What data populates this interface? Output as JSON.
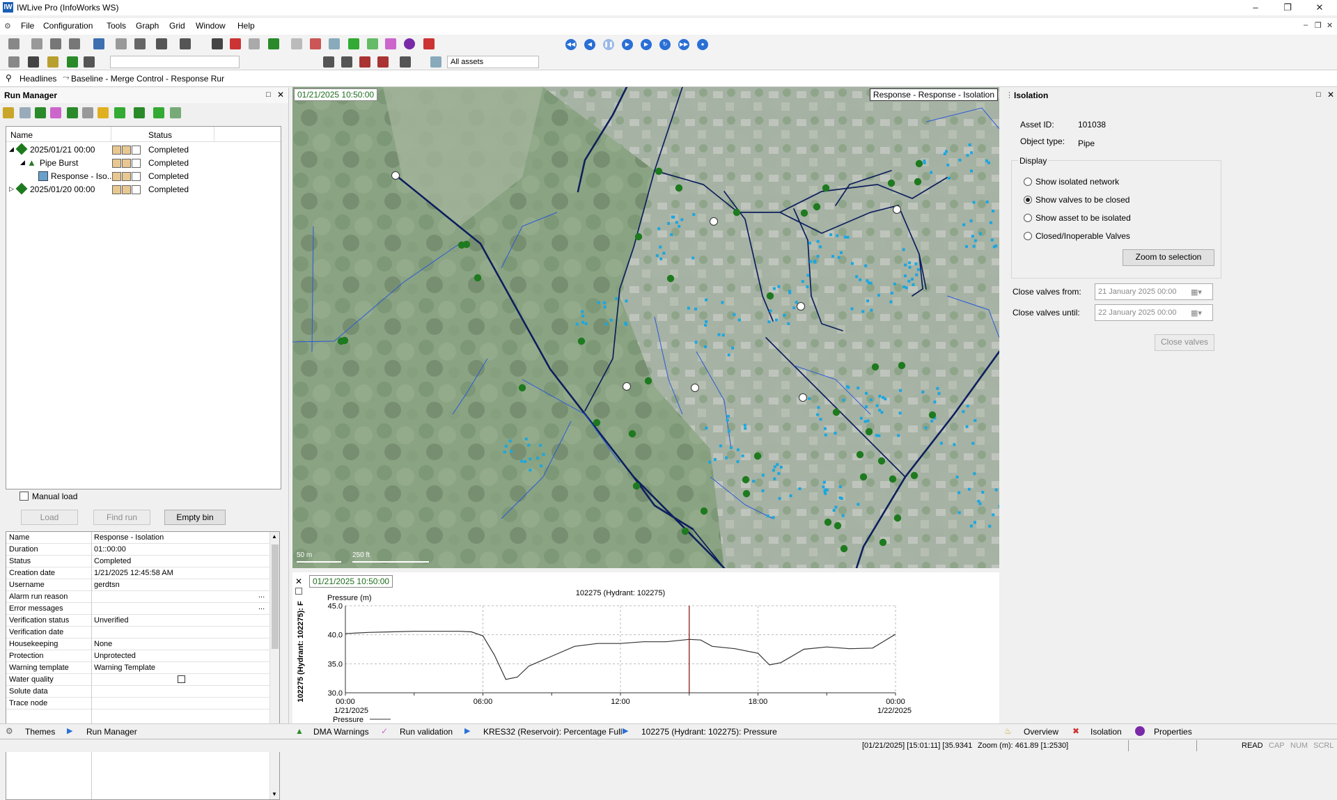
{
  "window": {
    "title": "IWLive Pro (InfoWorks WS)"
  },
  "menu": [
    "File",
    "Configuration",
    "Tools",
    "Graph",
    "Grid",
    "Window",
    "Help"
  ],
  "toolbar": {
    "asset_filter": "All assets"
  },
  "headlines": {
    "label": "Headlines",
    "breadcrumb": "Baseline - Merge Control - Response Rur"
  },
  "run_manager": {
    "title": "Run Manager",
    "columns": [
      "Name",
      "Status"
    ],
    "tree": [
      {
        "name": "2025/01/21 00:00",
        "status": "Completed",
        "level": 0
      },
      {
        "name": "Pipe Burst",
        "status": "Completed",
        "level": 1
      },
      {
        "name": "Response - Iso...",
        "status": "Completed",
        "level": 2
      },
      {
        "name": "2025/01/20 00:00",
        "status": "Completed",
        "level": 0
      }
    ],
    "manual_load": "Manual load",
    "buttons": {
      "load": "Load",
      "find_run": "Find run",
      "empty_bin": "Empty bin"
    },
    "properties": [
      {
        "name": "Name",
        "value": "Response - Isolation"
      },
      {
        "name": "Duration",
        "value": "01::00:00"
      },
      {
        "name": "Status",
        "value": "Completed"
      },
      {
        "name": "Creation date",
        "value": "1/21/2025 12:45:58 AM"
      },
      {
        "name": "Username",
        "value": "gerdtsn"
      },
      {
        "name": "Alarm run reason",
        "value": ""
      },
      {
        "name": "Error messages",
        "value": ""
      },
      {
        "name": "Verification status",
        "value": "Unverified"
      },
      {
        "name": "Verification date",
        "value": ""
      },
      {
        "name": "Housekeeping",
        "value": "None"
      },
      {
        "name": "Protection",
        "value": "Unprotected"
      },
      {
        "name": "Warning template",
        "value": "Warning Template"
      },
      {
        "name": "Water quality",
        "value": ""
      },
      {
        "name": "Solute data",
        "value": ""
      },
      {
        "name": "Trace node",
        "value": ""
      }
    ]
  },
  "map": {
    "timestamp": "01/21/2025 10:50:00",
    "title": "Response - Response - Isolation",
    "scale_1": "50 m",
    "scale_2": "250 ft"
  },
  "graph": {
    "timestamp": "01/21/2025 10:50:00",
    "side_label": "102275 (Hydrant: 102275): F",
    "chart_data": {
      "type": "line",
      "title": "102275 (Hydrant: 102275)",
      "ylabel": "Pressure (m)",
      "ylim": [
        30.0,
        45.0
      ],
      "yticks": [
        "45.0",
        "40.0",
        "35.0",
        "30.0"
      ],
      "xticks": [
        "00:00",
        "06:00",
        "12:00",
        "18:00",
        "00:00"
      ],
      "x_date_start": "1/21/2025",
      "x_date_end": "1/22/2025",
      "legend": "Pressure",
      "series": [
        {
          "name": "Pressure",
          "x": [
            0,
            1,
            2,
            3,
            4,
            5,
            5.5,
            6,
            6.5,
            7,
            7.5,
            8,
            9,
            10,
            11,
            12,
            13,
            14,
            15,
            15.5,
            16,
            17,
            18,
            18.5,
            19,
            20,
            21,
            22,
            23,
            24
          ],
          "values": [
            40.2,
            40.4,
            40.5,
            40.6,
            40.6,
            40.6,
            40.5,
            39.8,
            36.5,
            32.3,
            32.7,
            34.6,
            36.3,
            38.0,
            38.5,
            38.5,
            38.8,
            38.8,
            39.2,
            39.1,
            38.0,
            37.6,
            36.8,
            34.8,
            35.2,
            37.5,
            37.9,
            37.6,
            37.7,
            40.1
          ]
        }
      ],
      "cursor_x": 15
    }
  },
  "isolation": {
    "title": "Isolation",
    "asset_id_label": "Asset ID:",
    "asset_id": "101038",
    "object_type_label": "Object type:",
    "object_type": "Pipe",
    "display_label": "Display",
    "options": [
      {
        "label": "Show isolated network",
        "checked": false
      },
      {
        "label": "Show valves to be closed",
        "checked": true
      },
      {
        "label": "Show asset to be isolated",
        "checked": false
      },
      {
        "label": "Closed/Inoperable Valves",
        "checked": false
      }
    ],
    "zoom_button": "Zoom to selection",
    "close_from_label": "Close valves from:",
    "close_from_value": "21  January   2025  00:00",
    "close_until_label": "Close valves until:",
    "close_until_value": "22  January   2025  00:00",
    "close_button": "Close valves"
  },
  "bottom_tabs": {
    "left": [
      "Themes",
      "Run Manager"
    ],
    "center": [
      "DMA Warnings",
      "Run validation",
      "KRES32 (Reservoir): Percentage Full",
      "102275 (Hydrant: 102275): Pressure"
    ],
    "right": [
      "Overview",
      "Isolation",
      "Properties"
    ]
  },
  "status": {
    "coords": "[01/21/2025] [15:01:11] [35.9341",
    "zoom": "Zoom (m): 461.89 [1:2530]",
    "flags": [
      "READ",
      "CAP",
      "NUM",
      "SCRL"
    ]
  },
  "colors": {
    "pipe_main": "#0d1f5c",
    "pipe_minor": "#2a5ad8",
    "valve": "#1e7a1e",
    "node": "#1ba7e0"
  }
}
